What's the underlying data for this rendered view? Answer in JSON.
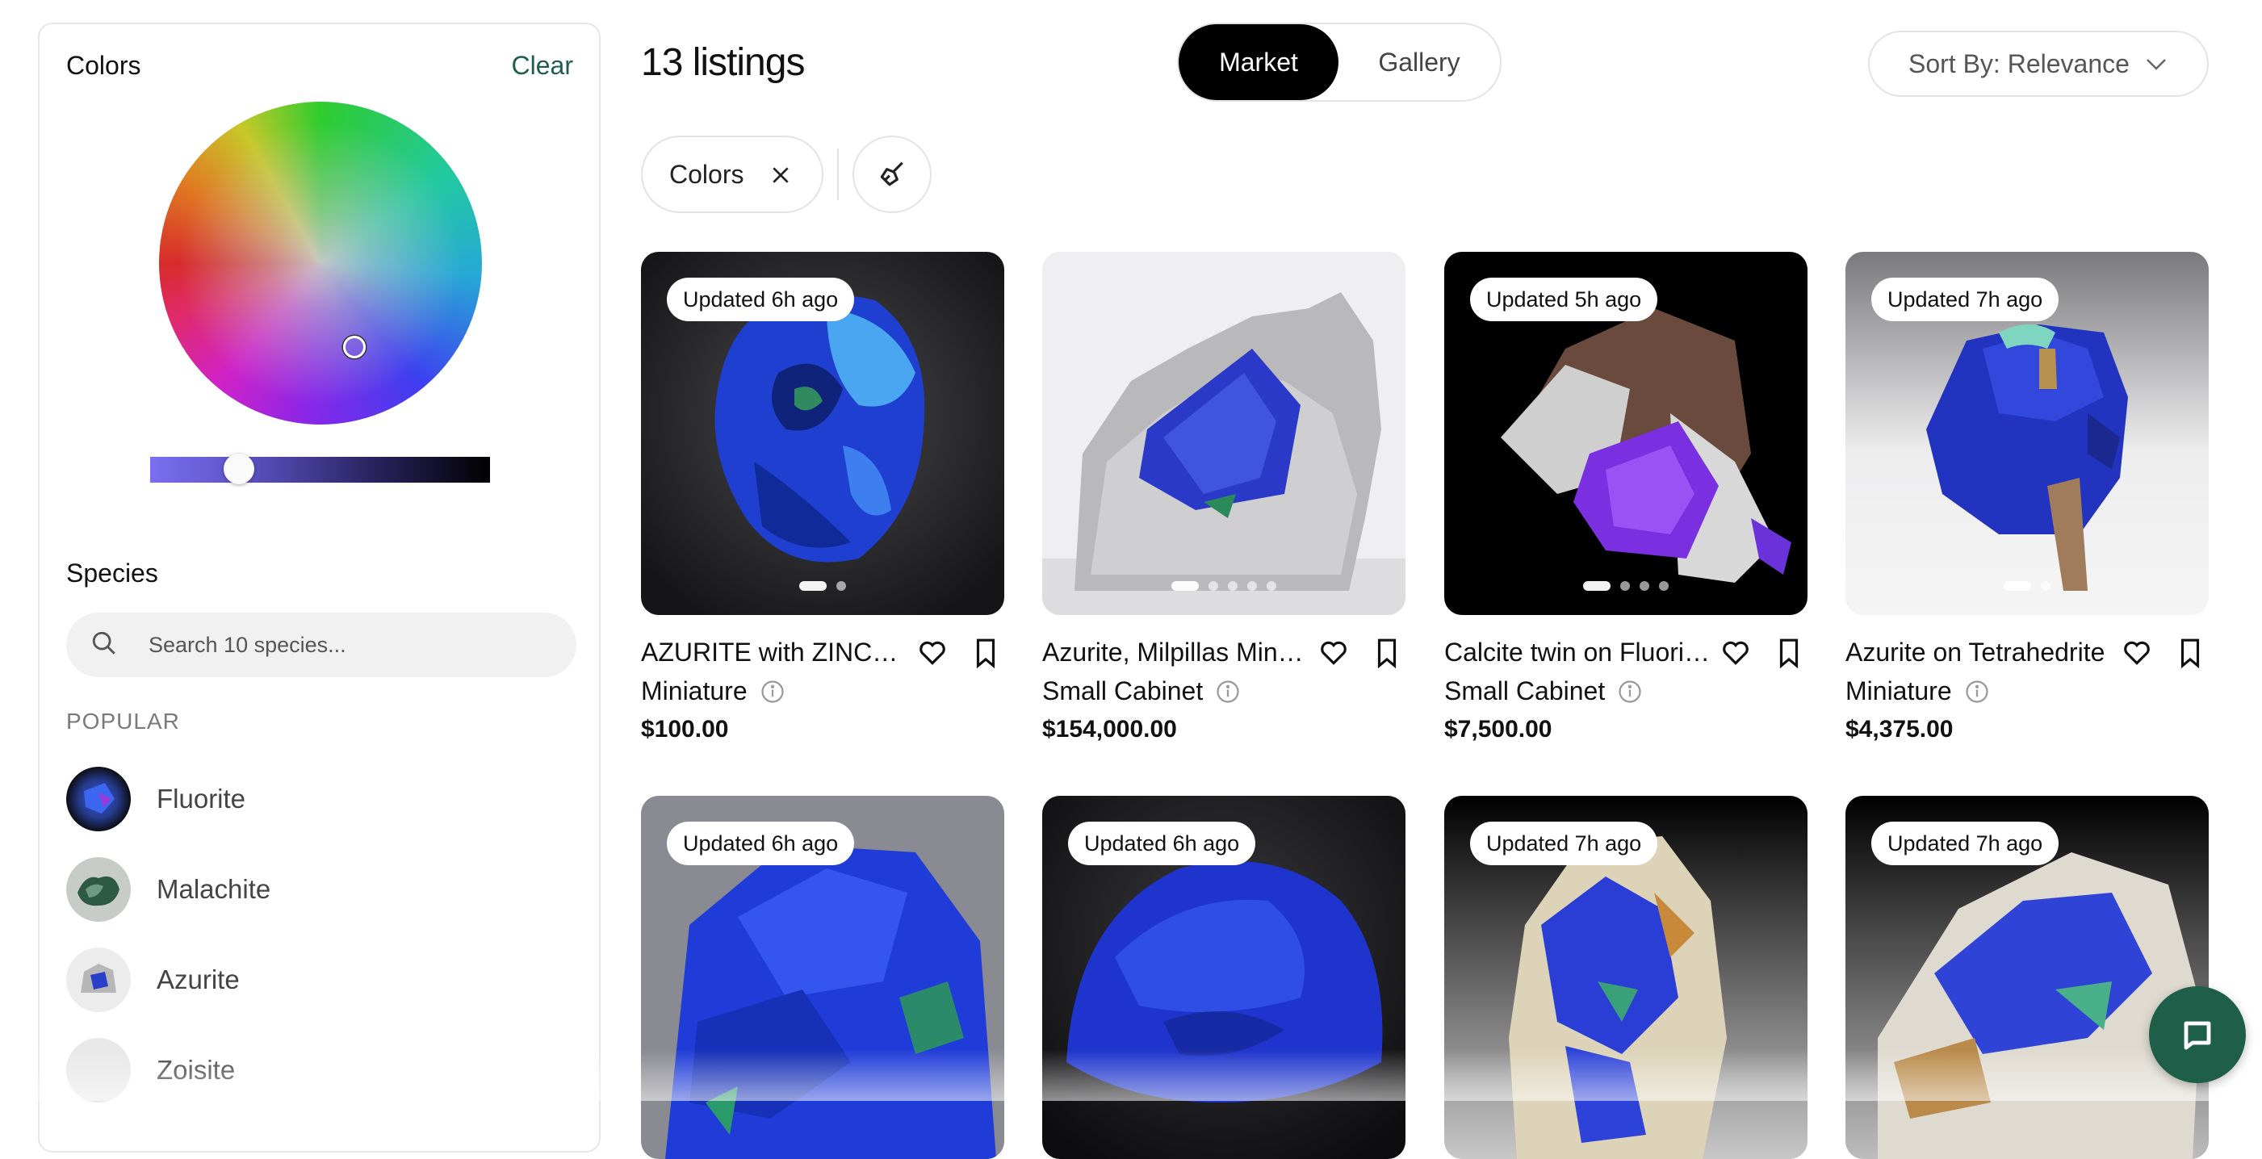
{
  "sidebar": {
    "colors_title": "Colors",
    "clear_label": "Clear",
    "species_title": "Species",
    "species_search_placeholder": "Search 10 species...",
    "popular_label": "POPULAR",
    "popular_species": [
      "Fluorite",
      "Malachite",
      "Azurite",
      "Zoisite"
    ]
  },
  "header": {
    "listing_count": "13 listings",
    "view_toggle": {
      "market": "Market",
      "gallery": "Gallery",
      "selected": "Market"
    },
    "sort_label": "Sort By: Relevance"
  },
  "filters": {
    "active_chip": "Colors"
  },
  "cards": [
    {
      "badge": "Updated 6h ago",
      "title": "AZURITE with ZINCO...",
      "size": "Miniature",
      "price": "$100.00"
    },
    {
      "badge": "",
      "title": "Azurite, Milpillas Mine...",
      "size": "Small Cabinet",
      "price": "$154,000.00"
    },
    {
      "badge": "Updated 5h ago",
      "title": "Calcite twin on Fluorit...",
      "size": "Small Cabinet",
      "price": "$7,500.00"
    },
    {
      "badge": "Updated 7h ago",
      "title": "Azurite on Tetrahedrite",
      "size": "Miniature",
      "price": "$4,375.00"
    },
    {
      "badge": "Updated 6h ago"
    },
    {
      "badge": "Updated 6h ago"
    },
    {
      "badge": "Updated 7h ago"
    },
    {
      "badge": "Updated 7h ago"
    }
  ],
  "colors": {
    "brand_green": "#1f5f4a",
    "toggle_active": "#000000"
  },
  "icons": [
    "search-icon",
    "close-icon",
    "clear-filters-icon",
    "chevron-down-icon",
    "heart-icon",
    "bookmark-icon",
    "info-icon",
    "chat-icon"
  ]
}
